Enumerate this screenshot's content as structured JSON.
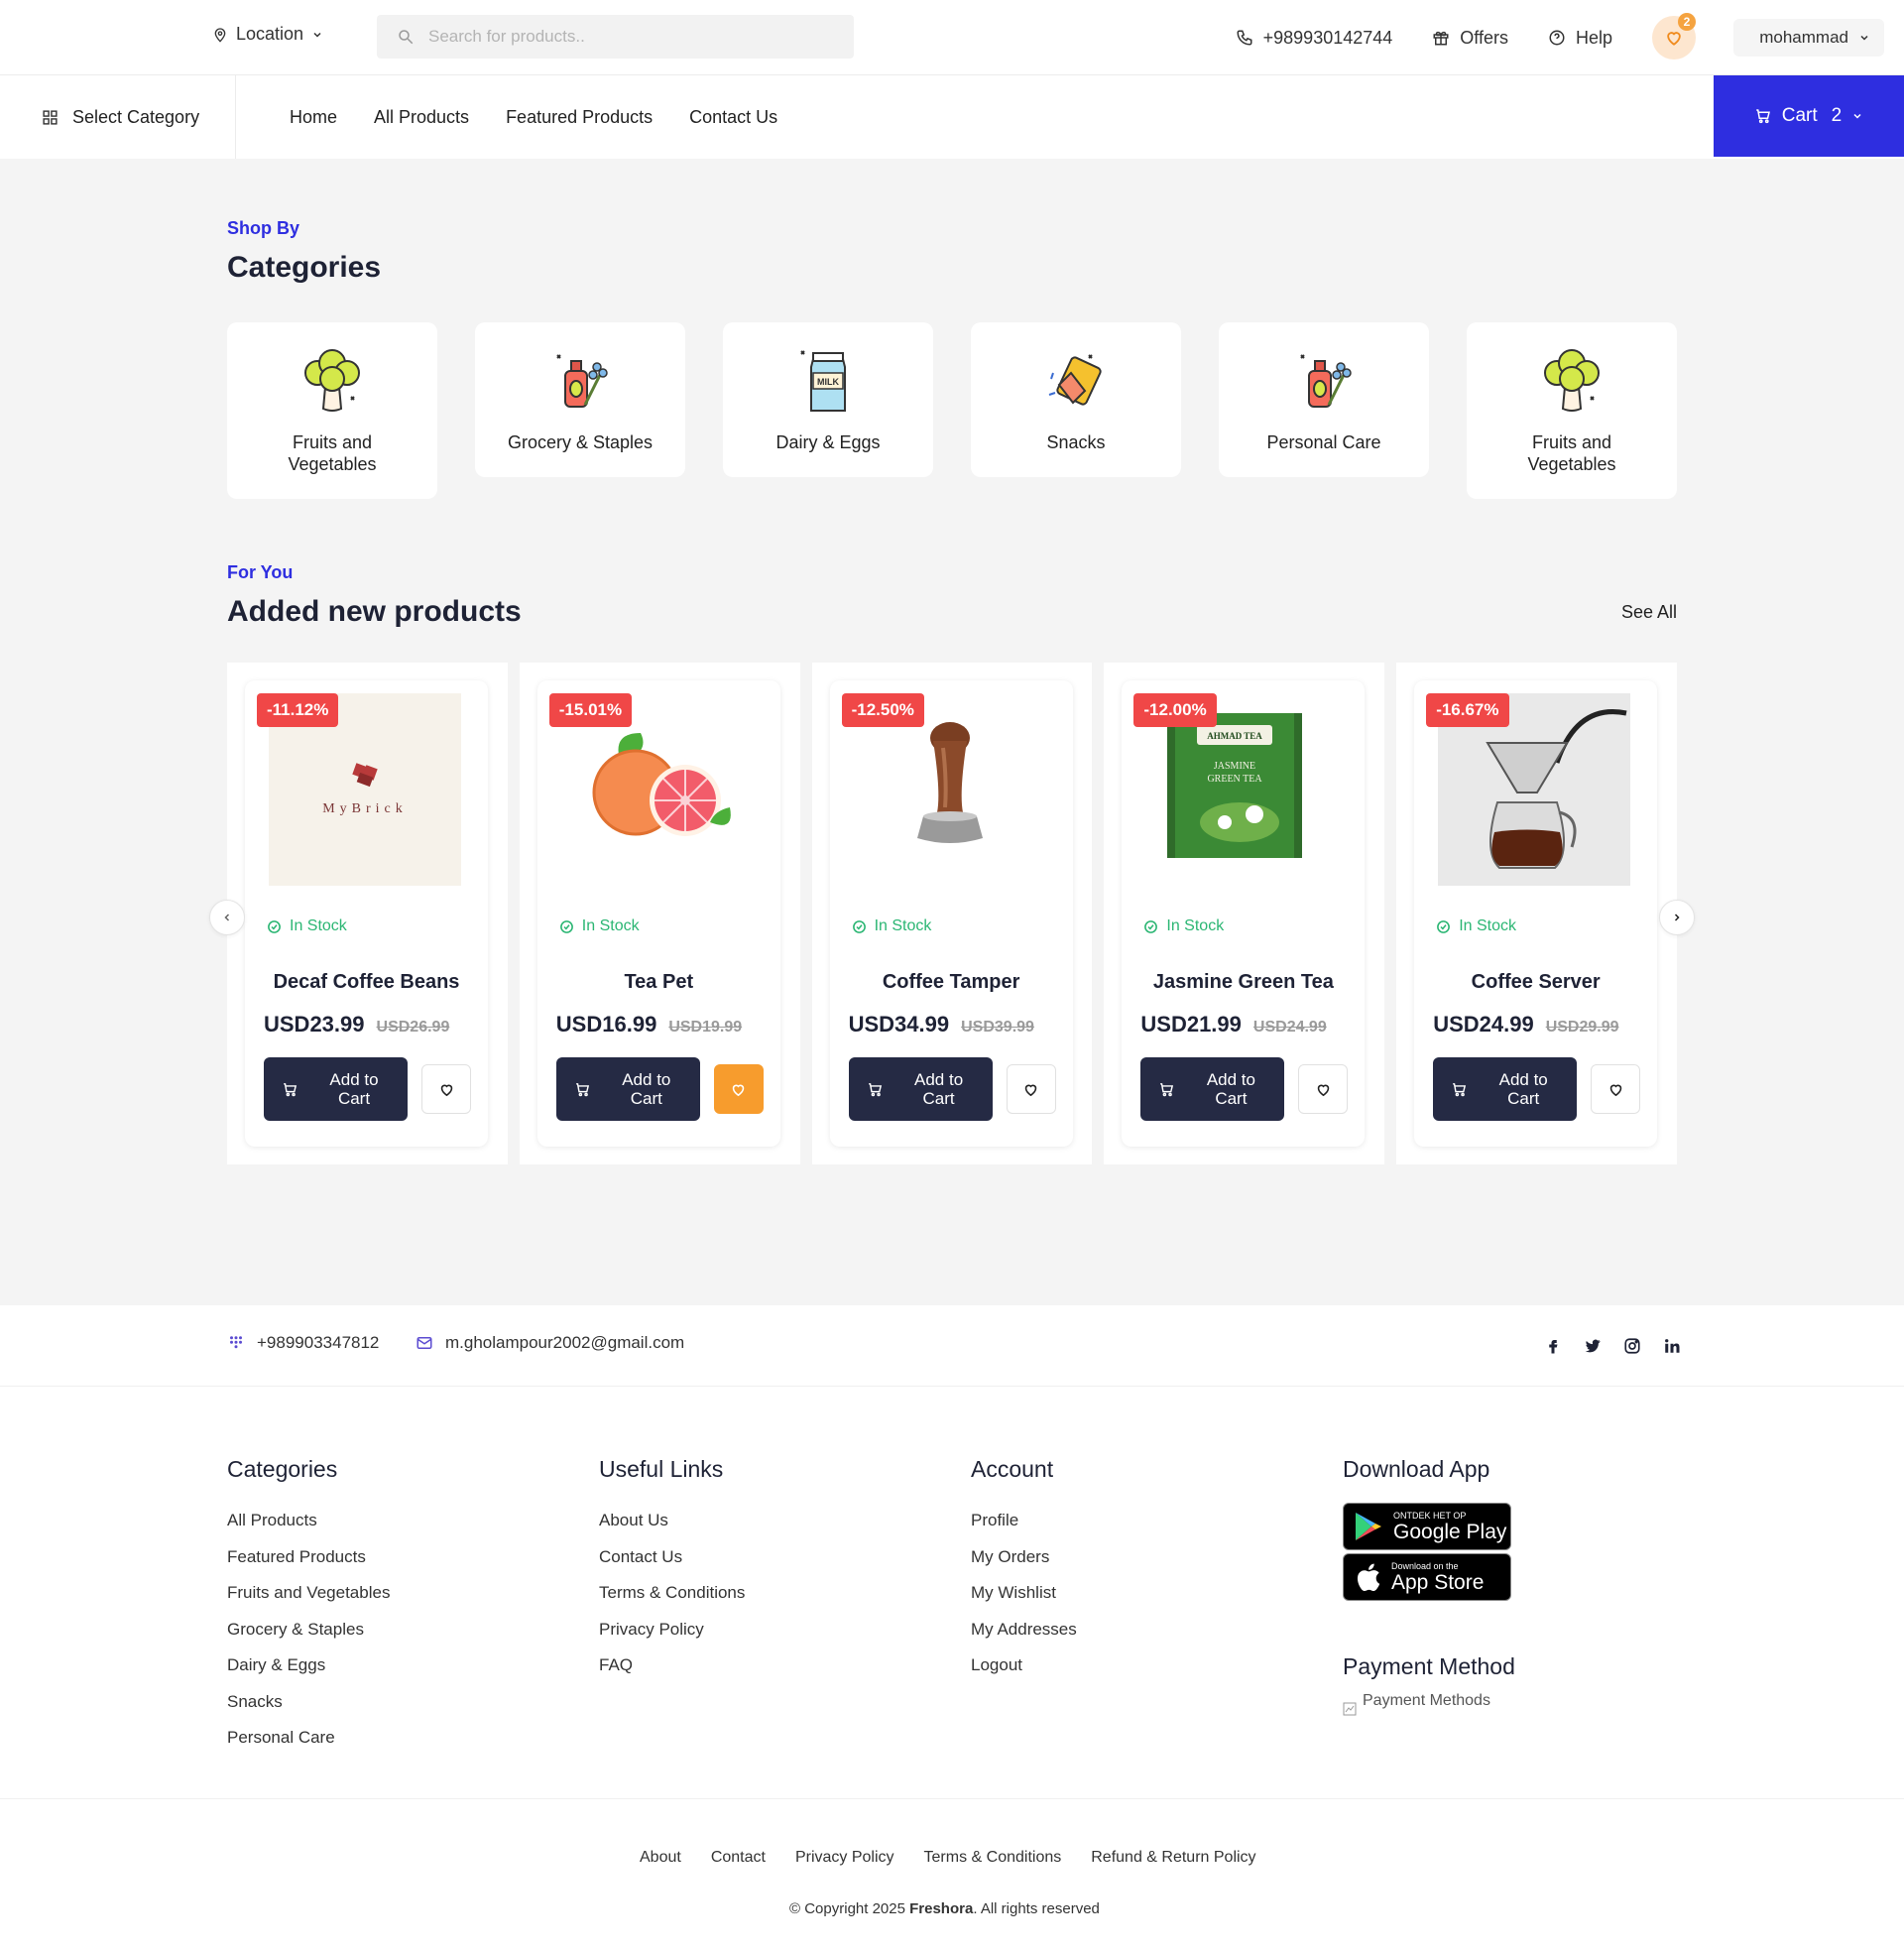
{
  "header": {
    "location": "Location",
    "search_placeholder": "Search for products..",
    "phone": "+989930142744",
    "offers": "Offers",
    "help": "Help",
    "wishlist_count": "2",
    "user": "mohammad"
  },
  "nav": {
    "select_category": "Select Category",
    "links": [
      "Home",
      "All Products",
      "Featured Products",
      "Contact Us"
    ],
    "cart_label": "Cart",
    "cart_count": "2",
    "accent": "#2e2ee0"
  },
  "categories": {
    "kicker": "Shop By",
    "title": "Categories",
    "items": [
      {
        "label": "Fruits and Vegetables",
        "icon": "broccoli-icon"
      },
      {
        "label": "Grocery & Staples",
        "icon": "grocery-bottle-icon"
      },
      {
        "label": "Dairy & Eggs",
        "icon": "milk-carton-icon"
      },
      {
        "label": "Snacks",
        "icon": "snacks-icon"
      },
      {
        "label": "Personal Care",
        "icon": "personal-care-icon"
      },
      {
        "label": "Fruits and Vegetables",
        "icon": "broccoli-icon"
      }
    ]
  },
  "products": {
    "kicker": "For You",
    "title": "Added new products",
    "see_all": "See All",
    "stock_label": "In Stock",
    "add_to_cart": "Add to Cart",
    "items": [
      {
        "name": "Decaf Coffee Beans",
        "discount": "-11.12%",
        "price": "USD23.99",
        "old_price": "USD26.99",
        "wishlisted": false,
        "image": "mybrick-logo-image",
        "image_text": "MyBrick"
      },
      {
        "name": "Tea Pet",
        "discount": "-15.01%",
        "price": "USD16.99",
        "old_price": "USD19.99",
        "wishlisted": true,
        "image": "grapefruit-image",
        "image_text": ""
      },
      {
        "name": "Coffee Tamper",
        "discount": "-12.50%",
        "price": "USD34.99",
        "old_price": "USD39.99",
        "wishlisted": false,
        "image": "coffee-tamper-image",
        "image_text": ""
      },
      {
        "name": "Jasmine Green Tea",
        "discount": "-12.00%",
        "price": "USD21.99",
        "old_price": "USD24.99",
        "wishlisted": false,
        "image": "jasmine-tea-box-image",
        "image_text": "AHMAD TEA JASMINE GREEN TEA"
      },
      {
        "name": "Coffee Server",
        "discount": "-16.67%",
        "price": "USD24.99",
        "old_price": "USD29.99",
        "wishlisted": false,
        "image": "coffee-server-image",
        "image_text": ""
      }
    ]
  },
  "footer": {
    "phone": "+989903347812",
    "email": "m.gholampour2002@gmail.com",
    "socials": [
      "facebook-icon",
      "twitter-icon",
      "instagram-icon",
      "linkedin-icon"
    ],
    "categories_title": "Categories",
    "categories": [
      "All Products",
      "Featured Products",
      "Fruits and Vegetables",
      "Grocery & Staples",
      "Dairy & Eggs",
      "Snacks",
      "Personal Care"
    ],
    "useful_title": "Useful Links",
    "useful": [
      "About Us",
      "Contact Us",
      "Terms & Conditions",
      "Privacy Policy",
      "FAQ"
    ],
    "account_title": "Account",
    "account": [
      "Profile",
      "My Orders",
      "My Wishlist",
      "My Addresses",
      "Logout"
    ],
    "download_title": "Download App",
    "google_small": "ONTDEK HET OP",
    "google_big": "Google Play",
    "apple_small": "Download on the",
    "apple_big": "App Store",
    "payment_title": "Payment Method",
    "payment_alt": "Payment Methods",
    "bottom_links": [
      "About",
      "Contact",
      "Privacy Policy",
      "Terms & Conditions",
      "Refund & Return Policy"
    ],
    "copyright_prefix": "© Copyright 2025",
    "brand": "Freshora",
    "copyright_suffix": ". All rights reserved"
  }
}
